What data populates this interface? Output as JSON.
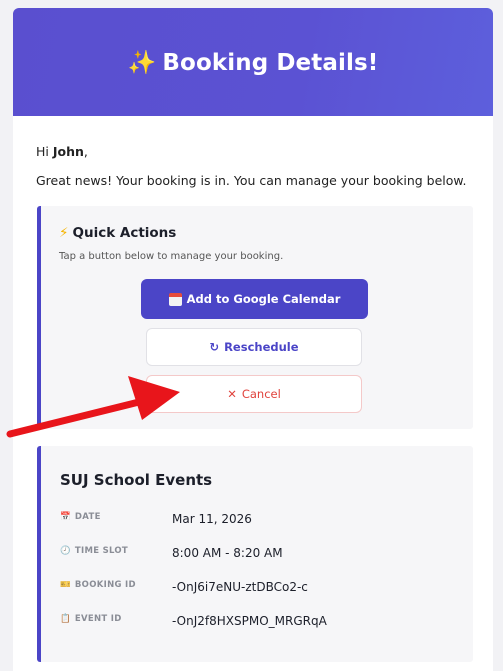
{
  "header": {
    "icon": "sparkles-icon",
    "title": "Booking Details!"
  },
  "greeting": {
    "prefix": "Hi",
    "name": "John",
    "suffix": ","
  },
  "intro": "Great news! Your booking is in. You can manage your booking below.",
  "quick_actions": {
    "icon": "lightning-icon",
    "title": "Quick Actions",
    "subtitle": "Tap a button below to manage your booking.",
    "buttons": [
      {
        "icon": "calendar-icon",
        "label": "Add to Google Calendar"
      },
      {
        "icon": "refresh-icon",
        "label": "Reschedule"
      },
      {
        "icon": "close-icon",
        "label": "Cancel"
      }
    ]
  },
  "event": {
    "title": "SUJ School Events",
    "rows": [
      {
        "icon": "calendar-icon",
        "label": "DATE",
        "value": "Mar 11, 2026"
      },
      {
        "icon": "clock-icon",
        "label": "TIME SLOT",
        "value": "8:00 AM - 8:20 AM"
      },
      {
        "icon": "ticket-icon",
        "label": "BOOKING ID",
        "value": "-OnJ6i7eNU-ztDBCo2-c"
      },
      {
        "icon": "clipboard-icon",
        "label": "EVENT ID",
        "value": "-OnJ2f8HXSPMO_MRGRqA"
      }
    ]
  },
  "colors": {
    "brand": "#4b45c7",
    "danger": "#e0433d",
    "annotation_arrow": "#e8151b"
  }
}
